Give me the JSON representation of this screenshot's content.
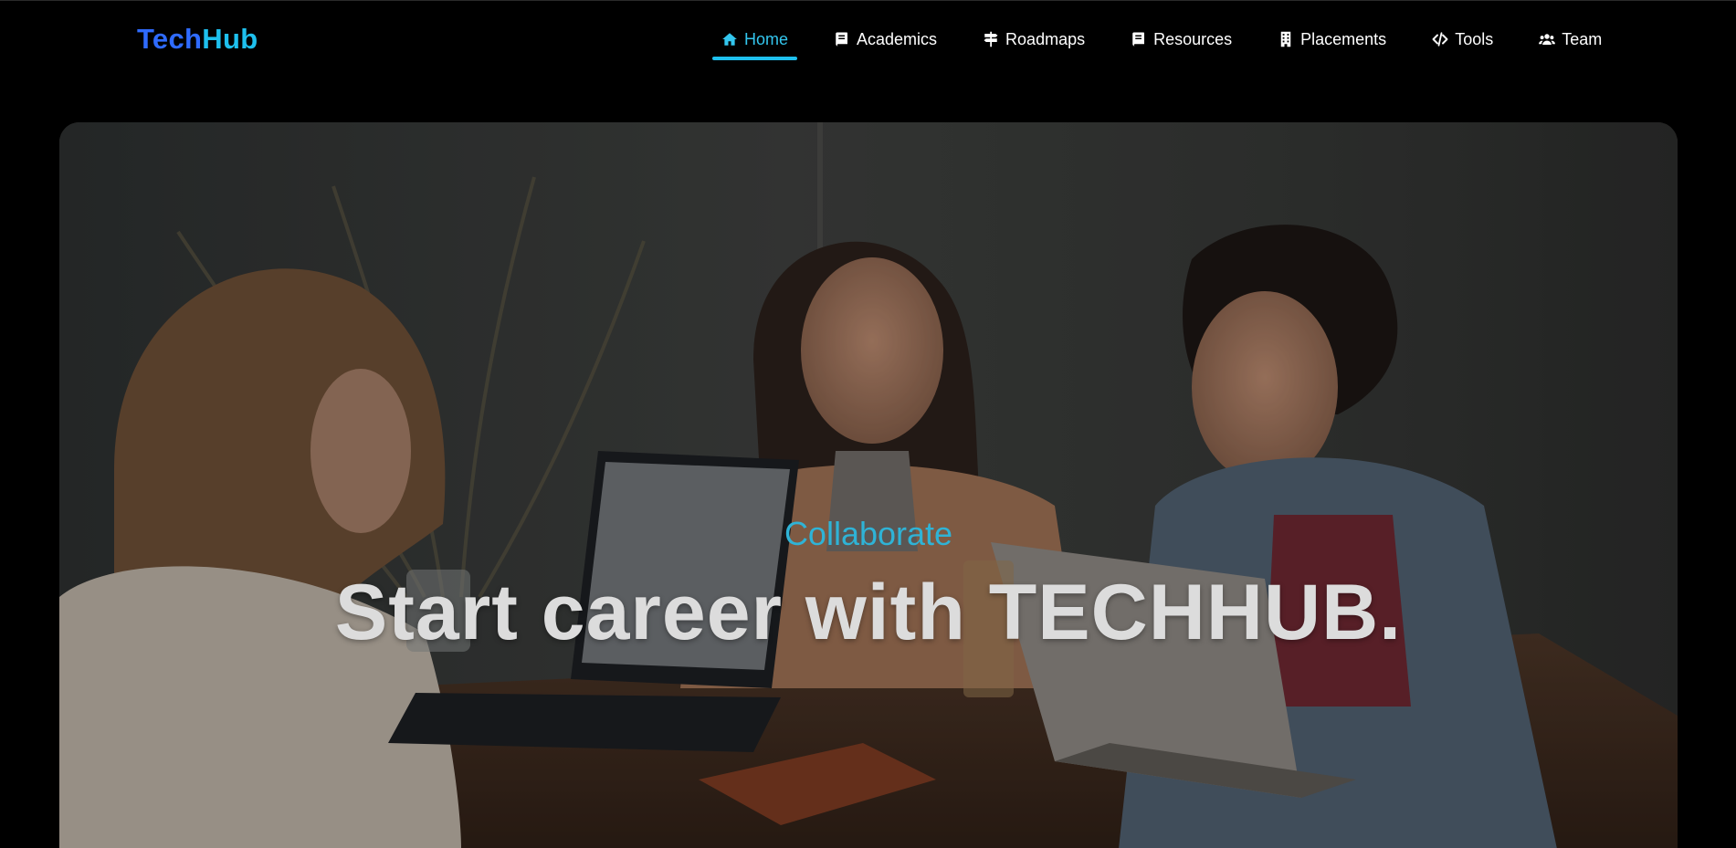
{
  "brand": {
    "part1": "Tech",
    "part2": "Hub",
    "color1": "#2f6bff",
    "color2": "#1ec0ee"
  },
  "nav": {
    "active": "Home",
    "accent_color": "#1ec0ee",
    "items": [
      {
        "label": "Home",
        "icon": "home-icon"
      },
      {
        "label": "Academics",
        "icon": "book-icon"
      },
      {
        "label": "Roadmaps",
        "icon": "signpost-icon"
      },
      {
        "label": "Resources",
        "icon": "book-icon"
      },
      {
        "label": "Placements",
        "icon": "building-icon"
      },
      {
        "label": "Tools",
        "icon": "code-icon"
      },
      {
        "label": "Team",
        "icon": "users-icon"
      }
    ]
  },
  "hero": {
    "subtitle": "Collaborate",
    "title": "Start career with TECHHUB.",
    "subtitle_color": "#2fb3d6",
    "image": "photo of three people laughing around a table with laptops"
  }
}
